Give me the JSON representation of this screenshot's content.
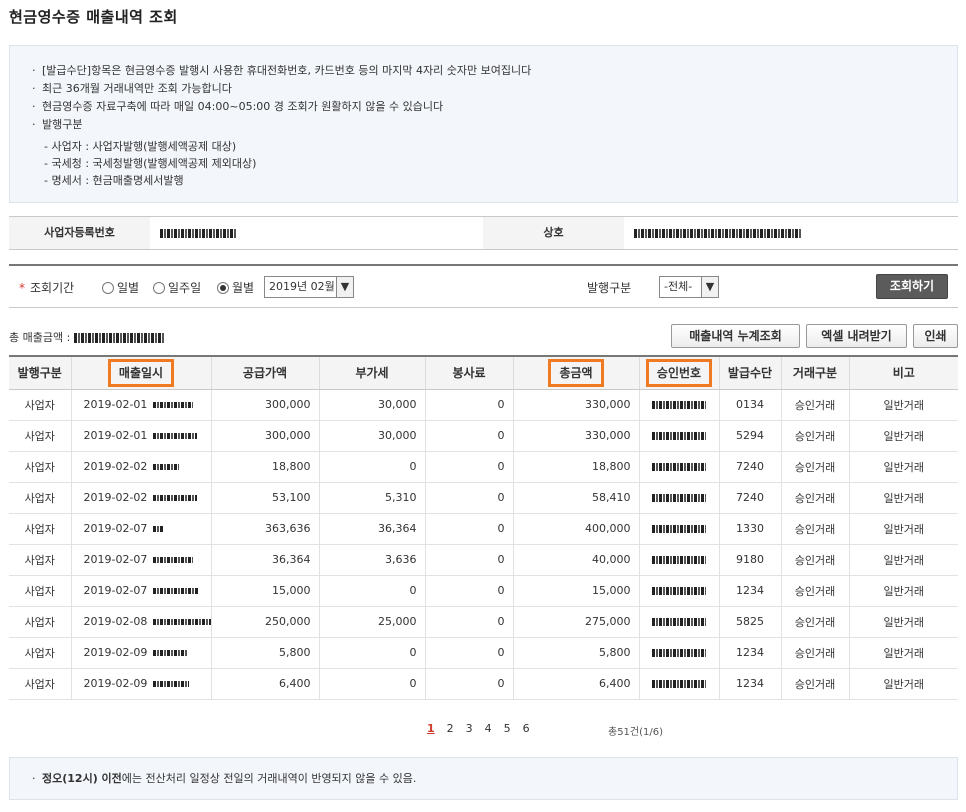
{
  "page": {
    "title": "현금영수증 매출내역 조회"
  },
  "notice": {
    "lines": [
      "[발급수단]항목은 현금영수증 발행시 사용한 휴대전화번호, 카드번호 등의 마지막 4자리 숫자만 보여집니다",
      "최근 36개월 거래내역만 조회 가능합니다",
      "현금영수증 자료구축에 따라 매일 04:00~05:00 경 조회가 원활하지 않을 수 있습니다",
      "발행구분"
    ],
    "sub_lines": [
      "- 사업자 : 사업자발행(발행세액공제 대상)",
      "- 국세청 : 국세청발행(발행세액공제 제외대상)",
      "- 명세서 : 현금매출명세서발행"
    ]
  },
  "info": {
    "biz_no_label": "사업자등록번호",
    "company_label": "상호"
  },
  "search": {
    "period_label": "조회기간",
    "radio_daily": "일별",
    "radio_weekly": "일주일",
    "radio_monthly": "월별",
    "month_value": "2019년 02월",
    "issue_type_label": "발행구분",
    "issue_type_value": "-전체-",
    "search_button": "조회하기"
  },
  "summary": {
    "total_label": "총 매출금액 :",
    "buttons": {
      "cumulative": "매출내역 누계조회",
      "excel": "엑셀 내려받기",
      "print": "인쇄"
    }
  },
  "table": {
    "headers": [
      "발행구분",
      "매출일시",
      "공급가액",
      "부가세",
      "봉사료",
      "총금액",
      "승인번호",
      "발급수단",
      "거래구분",
      "비고"
    ],
    "rows": [
      {
        "type": "사업자",
        "date": "2019-02-01",
        "supply": "300,000",
        "vat": "30,000",
        "service": "0",
        "total": "330,000",
        "means": "0134",
        "trade": "승인거래",
        "note": "일반거래"
      },
      {
        "type": "사업자",
        "date": "2019-02-01",
        "supply": "300,000",
        "vat": "30,000",
        "service": "0",
        "total": "330,000",
        "means": "5294",
        "trade": "승인거래",
        "note": "일반거래"
      },
      {
        "type": "사업자",
        "date": "2019-02-02",
        "supply": "18,800",
        "vat": "0",
        "service": "0",
        "total": "18,800",
        "means": "7240",
        "trade": "승인거래",
        "note": "일반거래"
      },
      {
        "type": "사업자",
        "date": "2019-02-02",
        "supply": "53,100",
        "vat": "5,310",
        "service": "0",
        "total": "58,410",
        "means": "7240",
        "trade": "승인거래",
        "note": "일반거래"
      },
      {
        "type": "사업자",
        "date": "2019-02-07",
        "supply": "363,636",
        "vat": "36,364",
        "service": "0",
        "total": "400,000",
        "means": "1330",
        "trade": "승인거래",
        "note": "일반거래"
      },
      {
        "type": "사업자",
        "date": "2019-02-07",
        "supply": "36,364",
        "vat": "3,636",
        "service": "0",
        "total": "40,000",
        "means": "9180",
        "trade": "승인거래",
        "note": "일반거래"
      },
      {
        "type": "사업자",
        "date": "2019-02-07",
        "supply": "15,000",
        "vat": "0",
        "service": "0",
        "total": "15,000",
        "means": "1234",
        "trade": "승인거래",
        "note": "일반거래"
      },
      {
        "type": "사업자",
        "date": "2019-02-08",
        "supply": "250,000",
        "vat": "25,000",
        "service": "0",
        "total": "275,000",
        "means": "5825",
        "trade": "승인거래",
        "note": "일반거래"
      },
      {
        "type": "사업자",
        "date": "2019-02-09",
        "supply": "5,800",
        "vat": "0",
        "service": "0",
        "total": "5,800",
        "means": "1234",
        "trade": "승인거래",
        "note": "일반거래"
      },
      {
        "type": "사업자",
        "date": "2019-02-09",
        "supply": "6,400",
        "vat": "0",
        "service": "0",
        "total": "6,400",
        "means": "1234",
        "trade": "승인거래",
        "note": "일반거래"
      }
    ]
  },
  "pagination": {
    "pages": [
      "1",
      "2",
      "3",
      "4",
      "5",
      "6"
    ],
    "current": "1",
    "count_text": "총51건(1/6)"
  },
  "footer": {
    "bold_text": "정오(12시) 이전",
    "rest_text": "에는 전산처리 일정상 전일의 거래내역이 반영되지 않을 수 있음."
  },
  "colors": {
    "highlight": "#f07a22",
    "accent_red": "#d43a2a",
    "link_blue": "#1a4fa5"
  }
}
